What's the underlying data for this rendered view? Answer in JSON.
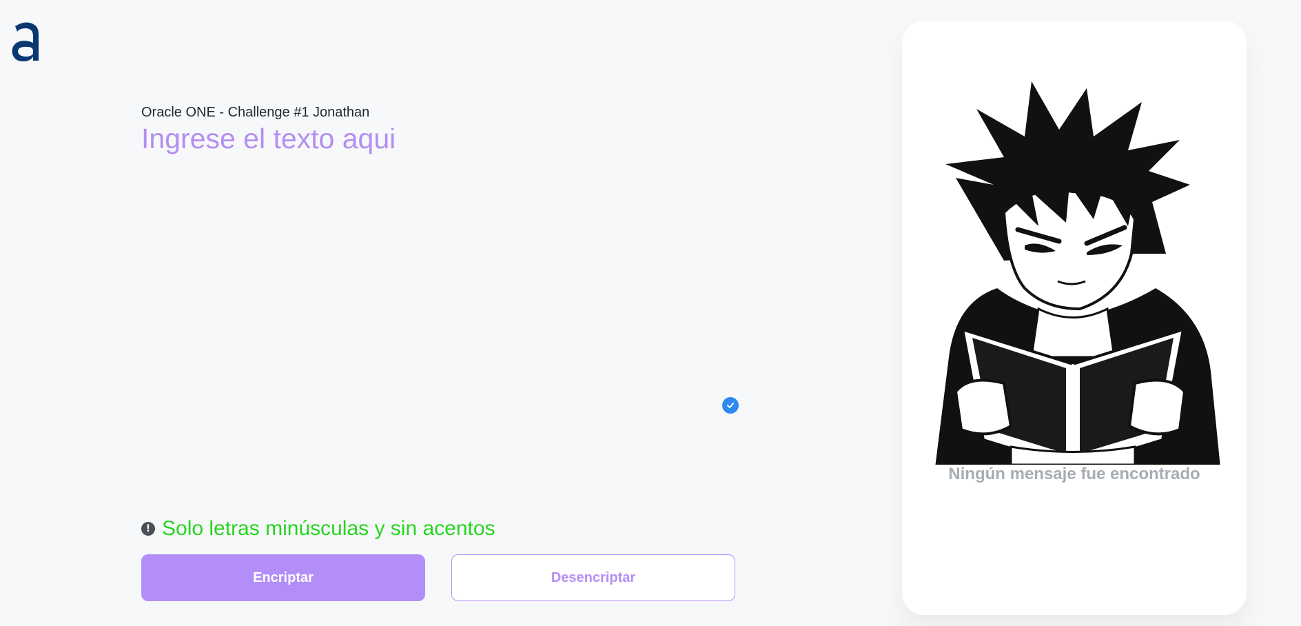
{
  "logo": {
    "icon": "a-logo-icon",
    "color": "#0a3871"
  },
  "header": {
    "subtitle": "Oracle ONE - Challenge #1 Jonathan"
  },
  "input": {
    "placeholder": "Ingrese el texto aqui",
    "value": ""
  },
  "hint": {
    "icon": "exclamation-icon",
    "text": "Solo letras minúsculas y sin acentos",
    "color": "#25d61d"
  },
  "actions": {
    "encrypt_label": "Encriptar",
    "decrypt_label": "Desencriptar"
  },
  "output": {
    "illustration": "anime-boy-reading-book-illustration",
    "empty_message": "Ningún mensaje fue encontrado"
  },
  "colors": {
    "accent": "#b48ef8",
    "background": "#f7f8fa",
    "card": "#ffffff"
  }
}
